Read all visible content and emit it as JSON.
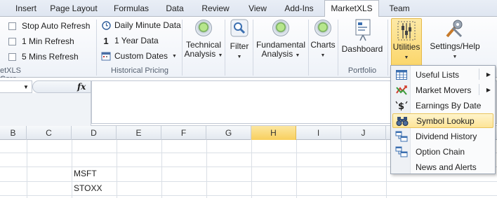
{
  "tabs": [
    {
      "label": "Insert",
      "active": false
    },
    {
      "label": "Page Layout",
      "active": false
    },
    {
      "label": "Formulas",
      "active": false
    },
    {
      "label": "Data",
      "active": false
    },
    {
      "label": "Review",
      "active": false
    },
    {
      "label": "View",
      "active": false
    },
    {
      "label": "Add-Ins",
      "active": false
    },
    {
      "label": "MarketXLS",
      "active": true
    },
    {
      "label": "Team",
      "active": false
    }
  ],
  "ribbon": {
    "core": {
      "checkboxes": [
        "Stop Auto Refresh",
        "1 Min Refresh",
        "5 Mins Refresh"
      ],
      "group_label": "etXLS Core"
    },
    "historical": {
      "daily_minute": "Daily Minute Data",
      "one_year_num": "1",
      "one_year": "1 Year Data",
      "custom_dates": "Custom Dates",
      "group_label": "Historical Pricing"
    },
    "technical": {
      "line1": "Technical",
      "line2": "Analysis"
    },
    "filter": {
      "label": "Filter"
    },
    "fundamental": {
      "line1": "Fundamental",
      "line2": "Analysis"
    },
    "charts": {
      "label": "Charts"
    },
    "dashboard": {
      "label": "Dashboard"
    },
    "portfolio_label": "Portfolio",
    "utilities": {
      "label": "Utilities"
    },
    "settings": {
      "label": "Settings/Help"
    }
  },
  "formula_bar": {
    "fx": "fx"
  },
  "columns": [
    "B",
    "C",
    "D",
    "E",
    "F",
    "G",
    "H",
    "I",
    "J"
  ],
  "selected_column": "H",
  "cells": {
    "d3": "MSFT",
    "d4": "STOXX"
  },
  "menu": {
    "items": [
      {
        "label": "Useful Lists",
        "icon": "table-icon",
        "submenu": true
      },
      {
        "label": "Market Movers",
        "icon": "market-movers-icon",
        "submenu": true
      },
      {
        "label": "Earnings By Date",
        "icon": "earnings-icon",
        "submenu": false
      },
      {
        "label": "Symbol Lookup",
        "icon": "binoculars-icon",
        "submenu": false,
        "highlighted": true
      },
      {
        "label": "Dividend History",
        "icon": "dividend-icon",
        "submenu": false
      },
      {
        "label": "Option Chain",
        "icon": "option-chain-icon",
        "submenu": false
      },
      {
        "label": "News and Alerts",
        "icon": "",
        "submenu": false
      }
    ]
  }
}
